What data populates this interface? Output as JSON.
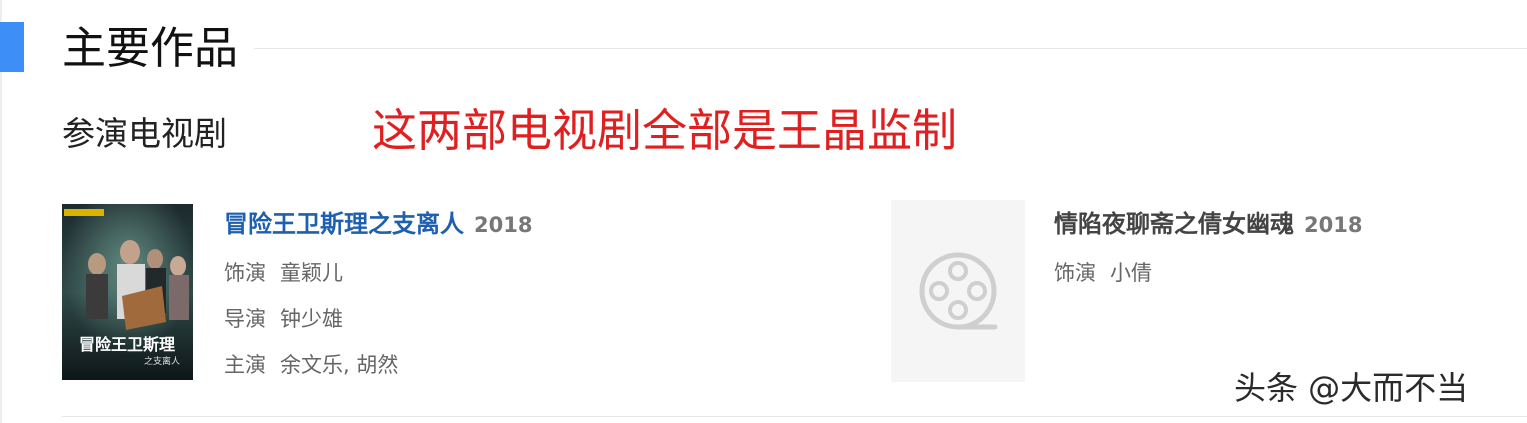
{
  "section": {
    "title": "主要作品"
  },
  "subsection": {
    "title": "参演电视剧"
  },
  "annotation": "这两部电视剧全部是王晶监制",
  "works": [
    {
      "title": "冒险王卫斯理之支离人",
      "year": "2018",
      "poster_text": "冒险王卫斯理",
      "poster_subtext": "之支离人",
      "credits": [
        {
          "label": "饰演",
          "value": "童颖儿"
        },
        {
          "label": "导演",
          "value": "钟少雄"
        },
        {
          "label": "主演",
          "value": "余文乐, 胡然"
        }
      ]
    },
    {
      "title": "情陷夜聊斋之倩女幽魂",
      "year": "2018",
      "poster_icon": "film-reel-icon",
      "credits": [
        {
          "label": "饰演",
          "value": "小倩"
        }
      ]
    }
  ],
  "watermark": "头条 @大而不当",
  "colors": {
    "accent": "#3e8ef7",
    "annotation": "#e02020",
    "link": "#1f5fb0"
  }
}
